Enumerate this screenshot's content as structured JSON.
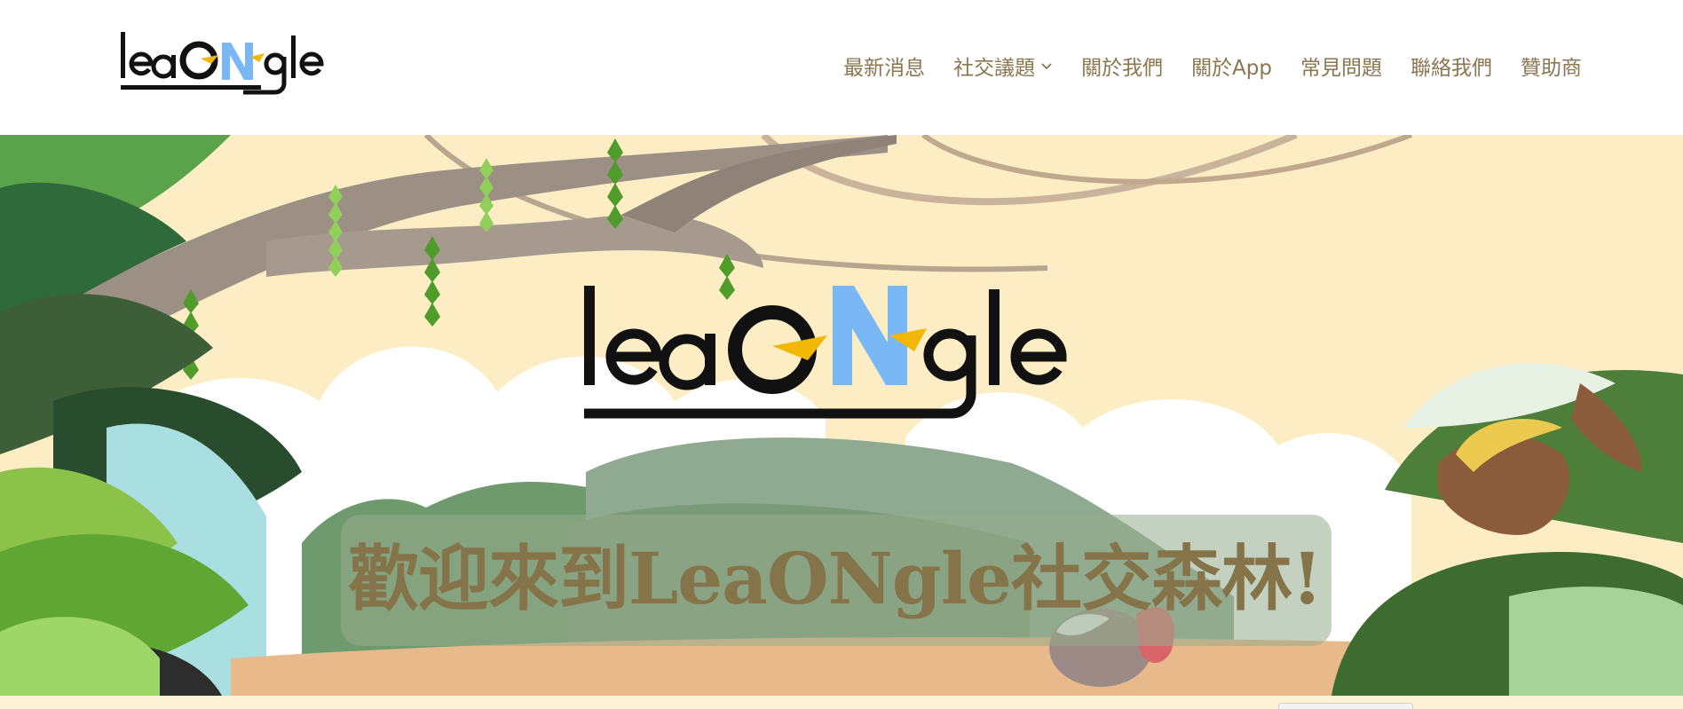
{
  "brand": {
    "logo_text": "leaONgle",
    "colors": {
      "black": "#111111",
      "blue": "#7ab8f5",
      "yellow": "#f2b705"
    }
  },
  "nav": {
    "items": [
      {
        "label": "最新消息"
      },
      {
        "label": "社交議題",
        "has_dropdown": true
      },
      {
        "label": "關於我們"
      },
      {
        "label": "關於App"
      },
      {
        "label": "常見問題"
      },
      {
        "label": "聯絡我們"
      },
      {
        "label": "贊助商"
      }
    ],
    "text_color": "#8a7650",
    "dropdown_icon": "chevron-down-icon"
  },
  "hero": {
    "welcome": "歡迎來到LeaONgle社交森林!",
    "text_color": "#85744a",
    "sky_color": "#fcedc4"
  }
}
